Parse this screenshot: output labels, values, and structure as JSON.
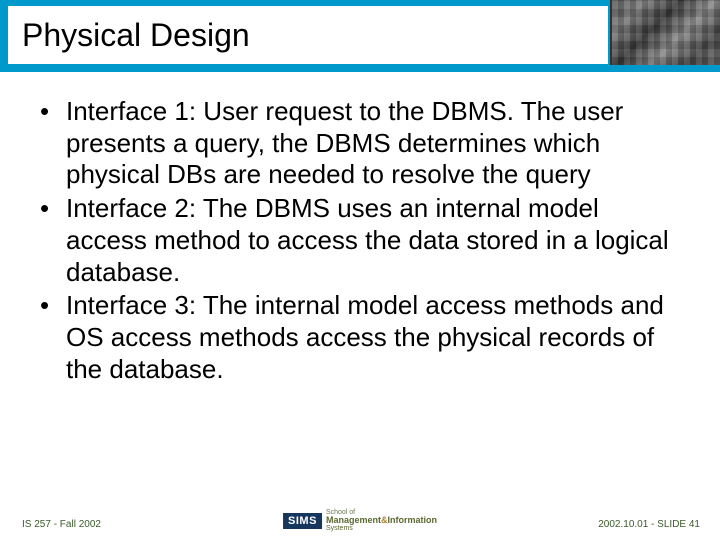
{
  "header": {
    "title": "Physical Design"
  },
  "body": {
    "bullets": [
      "Interface 1: User request to the DBMS. The user presents a query, the DBMS determines which physical DBs are needed to resolve the query",
      "Interface 2: The DBMS uses an internal model access method to access the data stored in a logical database.",
      "Interface 3:  The internal model access methods and  OS access methods access the physical records of the database."
    ]
  },
  "footer": {
    "left": "IS 257 - Fall 2002",
    "right": "2002.10.01 - SLIDE 41",
    "logo": {
      "acronym": "SIMS",
      "line1": "School of",
      "line2": "Information",
      "line3": "Systems",
      "line2_prefix": "Management",
      "amp": "&"
    }
  }
}
